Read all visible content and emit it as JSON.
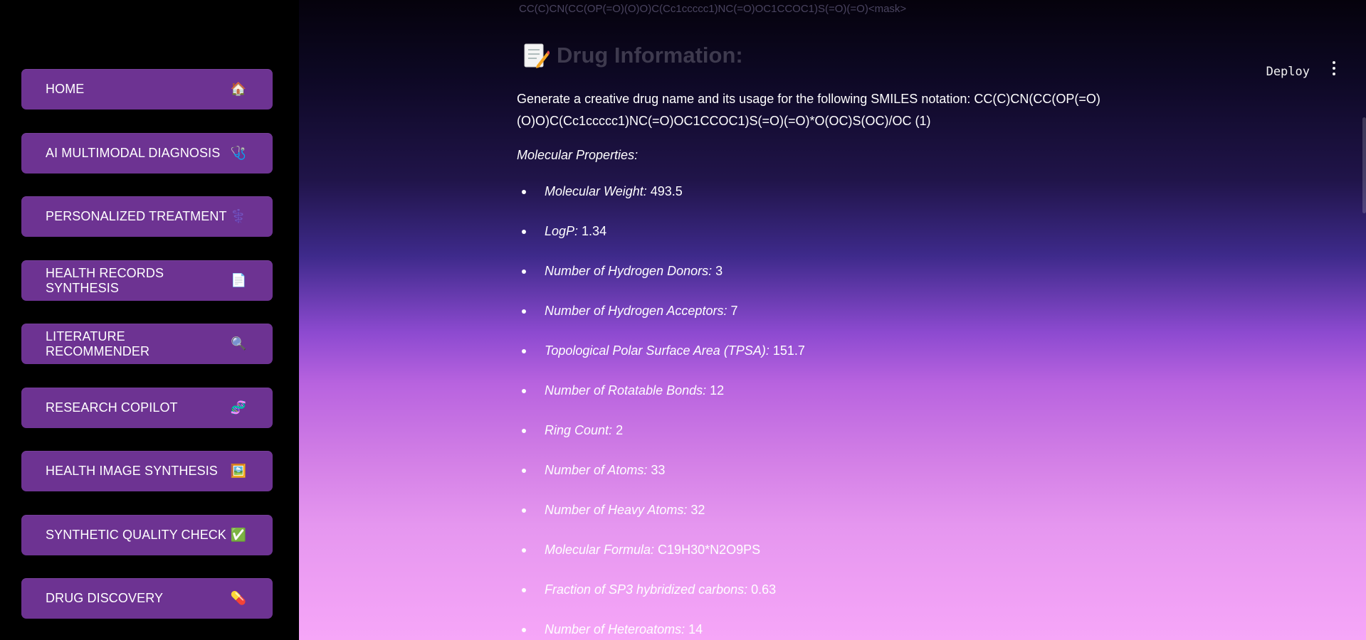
{
  "sidebar": {
    "items": [
      {
        "label": "HOME",
        "icon": "🏠",
        "icon_name": "house-icon"
      },
      {
        "label": "AI MULTIMODAL DIAGNOSIS",
        "icon": "🩺",
        "icon_name": "stethoscope-icon"
      },
      {
        "label": "PERSONALIZED TREATMENT",
        "icon": "⚕️",
        "icon_name": "medical-symbol-icon"
      },
      {
        "label": "HEALTH RECORDS SYNTHESIS",
        "icon": "📄",
        "icon_name": "document-icon"
      },
      {
        "label": "LITERATURE RECOMMENDER",
        "icon": "🔍",
        "icon_name": "magnifier-icon"
      },
      {
        "label": "RESEARCH COPILOT",
        "icon": "🧬",
        "icon_name": "dna-icon"
      },
      {
        "label": "HEALTH IMAGE SYNTHESIS",
        "icon": "🖼️",
        "icon_name": "picture-icon"
      },
      {
        "label": "SYNTHETIC QUALITY CHECK",
        "icon": "✅",
        "icon_name": "check-mark-icon"
      },
      {
        "label": "DRUG DISCOVERY",
        "icon": "💊",
        "icon_name": "pill-icon"
      }
    ]
  },
  "header": {
    "deploy_label": "Deploy"
  },
  "main": {
    "smiles_top": "CC(C)CN(CC(OP(=O)(O)O)C(Cc1ccccc1)NC(=O)OC1CCOC1)S(=O)(=O)<mask>",
    "title": "Drug Information:",
    "prompt": "Generate a creative drug name and its usage for the following SMILES notation: CC(C)CN(CC(OP(=O)(O)O)C(Cc1ccccc1)NC(=O)OC1CCOC1)S(=O)(=O)*O(OC)S(OC)/OC (1)",
    "properties_label": "Molecular Properties:",
    "properties": [
      {
        "name": "Molecular Weight:",
        "value": "493.5"
      },
      {
        "name": "LogP:",
        "value": "1.34"
      },
      {
        "name": "Number of Hydrogen Donors:",
        "value": "3"
      },
      {
        "name": "Number of Hydrogen Acceptors:",
        "value": "7"
      },
      {
        "name": "Topological Polar Surface Area (TPSA):",
        "value": "151.7"
      },
      {
        "name": "Number of Rotatable Bonds:",
        "value": "12"
      },
      {
        "name": "Ring Count:",
        "value": "2"
      },
      {
        "name": "Number of Atoms:",
        "value": "33"
      },
      {
        "name": "Number of Heavy Atoms:",
        "value": "32"
      },
      {
        "name": "Molecular Formula:",
        "value": "C19H30*N2O9PS"
      },
      {
        "name": "Fraction of SP3 hybridized carbons:",
        "value": "0.63"
      },
      {
        "name": "Number of Heteroatoms:",
        "value": "14"
      }
    ]
  },
  "colors": {
    "sidebar_bg": "#000000",
    "nav_button": "#6d3392",
    "heading_text": "#3e3a4e"
  }
}
